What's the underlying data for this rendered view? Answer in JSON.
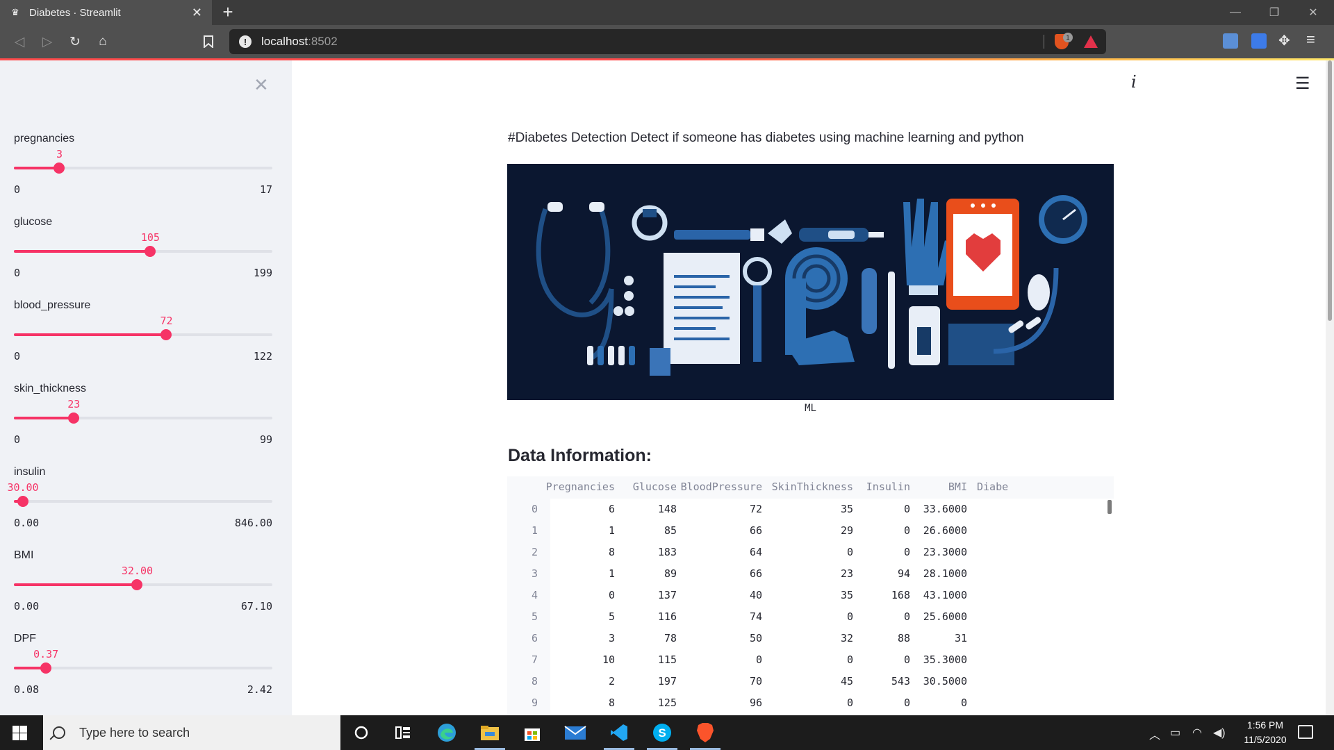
{
  "browser": {
    "tab_title": "Diabetes · Streamlit",
    "url_host": "localhost",
    "url_port": ":8502",
    "shield_count": "1"
  },
  "sidebar": {
    "sliders": [
      {
        "label": "pregnancies",
        "value": "3",
        "min": "0",
        "max": "17",
        "fraction": 0.176
      },
      {
        "label": "glucose",
        "value": "105",
        "min": "0",
        "max": "199",
        "fraction": 0.528
      },
      {
        "label": "blood_pressure",
        "value": "72",
        "min": "0",
        "max": "122",
        "fraction": 0.59
      },
      {
        "label": "skin_thickness",
        "value": "23",
        "min": "0",
        "max": "99",
        "fraction": 0.232
      },
      {
        "label": "insulin",
        "value": "30.00",
        "min": "0.00",
        "max": "846.00",
        "fraction": 0.035
      },
      {
        "label": "BMI",
        "value": "32.00",
        "min": "0.00",
        "max": "67.10",
        "fraction": 0.477
      },
      {
        "label": "DPF",
        "value": "0.37",
        "min": "0.08",
        "max": "2.42",
        "fraction": 0.124
      }
    ]
  },
  "main": {
    "intro": "#Diabetes Detection Detect if someone has diabetes using machine learning and python",
    "image_caption": "ML",
    "section_title": "Data Information:",
    "table": {
      "columns": [
        "",
        "Pregnancies",
        "Glucose",
        "BloodPressure",
        "SkinThickness",
        "Insulin",
        "BMI",
        "Diabe"
      ],
      "rows": [
        [
          "0",
          "6",
          "148",
          "72",
          "35",
          "0",
          "33.6000"
        ],
        [
          "1",
          "1",
          "85",
          "66",
          "29",
          "0",
          "26.6000"
        ],
        [
          "2",
          "8",
          "183",
          "64",
          "0",
          "0",
          "23.3000"
        ],
        [
          "3",
          "1",
          "89",
          "66",
          "23",
          "94",
          "28.1000"
        ],
        [
          "4",
          "0",
          "137",
          "40",
          "35",
          "168",
          "43.1000"
        ],
        [
          "5",
          "5",
          "116",
          "74",
          "0",
          "0",
          "25.6000"
        ],
        [
          "6",
          "3",
          "78",
          "50",
          "32",
          "88",
          "31"
        ],
        [
          "7",
          "10",
          "115",
          "0",
          "0",
          "0",
          "35.3000"
        ],
        [
          "8",
          "2",
          "197",
          "70",
          "45",
          "543",
          "30.5000"
        ],
        [
          "9",
          "8",
          "125",
          "96",
          "0",
          "0",
          "0"
        ]
      ]
    }
  },
  "taskbar": {
    "search_placeholder": "Type here to search",
    "time": "1:56 PM",
    "date": "11/5/2020"
  },
  "colors": {
    "accent": "#f63366",
    "sidebar_bg": "#f0f2f6",
    "banner_bg": "#0b1730"
  }
}
